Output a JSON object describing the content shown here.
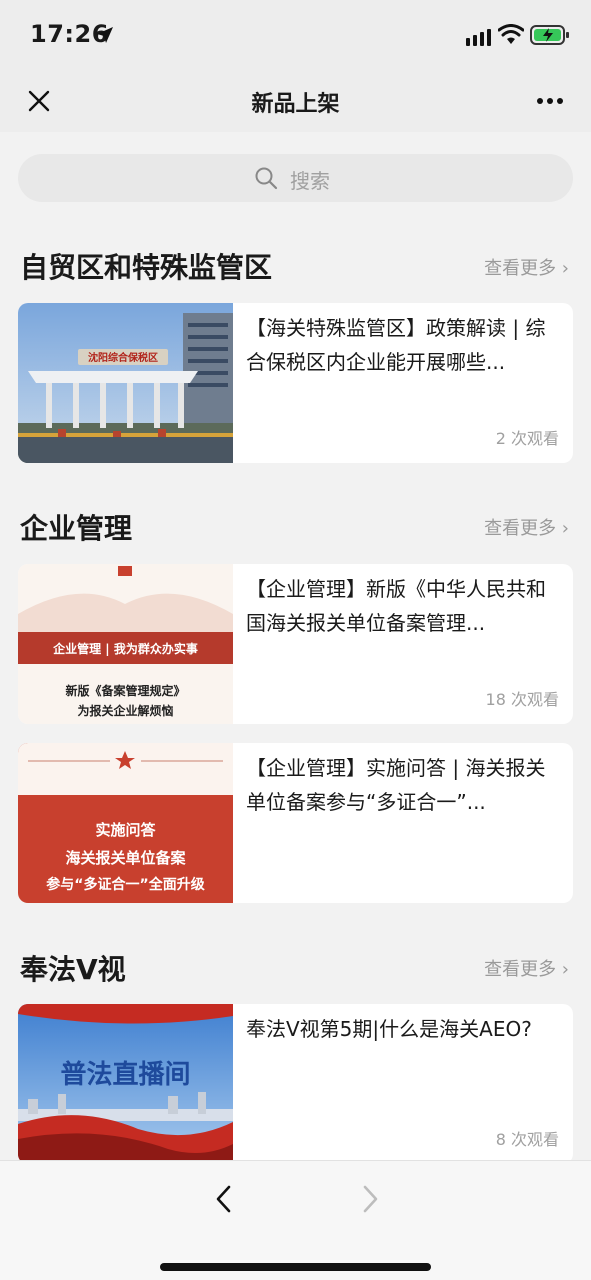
{
  "status": {
    "time": "17:26"
  },
  "nav": {
    "title": "新品上架"
  },
  "search": {
    "placeholder": "搜索"
  },
  "sections": [
    {
      "title": "自贸区和特殊监管区",
      "more": "查看更多",
      "items": [
        {
          "title": "【海关特殊监管区】政策解读 | 综合保税区内企业能开展哪些...",
          "views": "2 次观看",
          "thumb_sign": "沈阳综合保税区"
        }
      ]
    },
    {
      "title": "企业管理",
      "more": "查看更多",
      "items": [
        {
          "title": "【企业管理】新版《中华人民共和国海关报关单位备案管理...",
          "views": "18 次观看",
          "thumb_banner": "企业管理 | 我为群众办实事",
          "thumb_line1": "新版《备案管理规定》",
          "thumb_line2": "为报关企业解烦恼"
        },
        {
          "title": "【企业管理】实施问答 | 海关报关单位备案参与“多证合一”...",
          "thumb_line1": "实施问答",
          "thumb_line2": "海关报关单位备案",
          "thumb_line3": "参与“多证合一”全面升级"
        }
      ]
    },
    {
      "title": "奉法V视",
      "more": "查看更多",
      "items": [
        {
          "title": "奉法V视第5期|什么是海关AEO?",
          "views": "8 次观看",
          "thumb_text": "普法直播间"
        }
      ]
    }
  ],
  "colors": {
    "red": "#c8402e",
    "grey_text": "#9a9a9a"
  }
}
